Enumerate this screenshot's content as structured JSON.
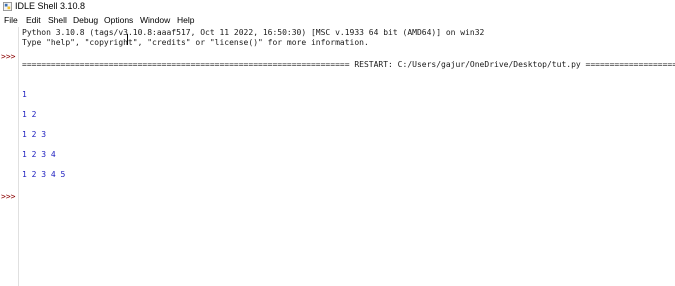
{
  "window": {
    "title": "IDLE Shell 3.10.8",
    "icon": "python-idle-icon"
  },
  "menu": [
    {
      "label": "File"
    },
    {
      "label": "Edit"
    },
    {
      "label": "Shell"
    },
    {
      "label": "Debug"
    },
    {
      "label": "Options"
    },
    {
      "label": "Window"
    },
    {
      "label": "Help"
    }
  ],
  "shell": {
    "prompt": ">>>",
    "banner": [
      "Python 3.10.8 (tags/v3.10.8:aaaf517, Oct 11 2022, 16:50:30) [MSC v.1933 64 bit (AMD64)] on win32",
      "Type \"help\", \"copyright\", \"credits\" or \"license()\" for more information."
    ],
    "restart_line": "==================================================================== RESTART: C:/Users/gajur/OneDrive/Desktop/tut.py ==================================================================",
    "output": [
      "1",
      "1 2",
      "1 2 3",
      "1 2 3 4",
      "1 2 3 4 5"
    ]
  },
  "colors": {
    "prompt": "#8b0000",
    "output": "#2020c0",
    "text": "#1a1a1a"
  }
}
